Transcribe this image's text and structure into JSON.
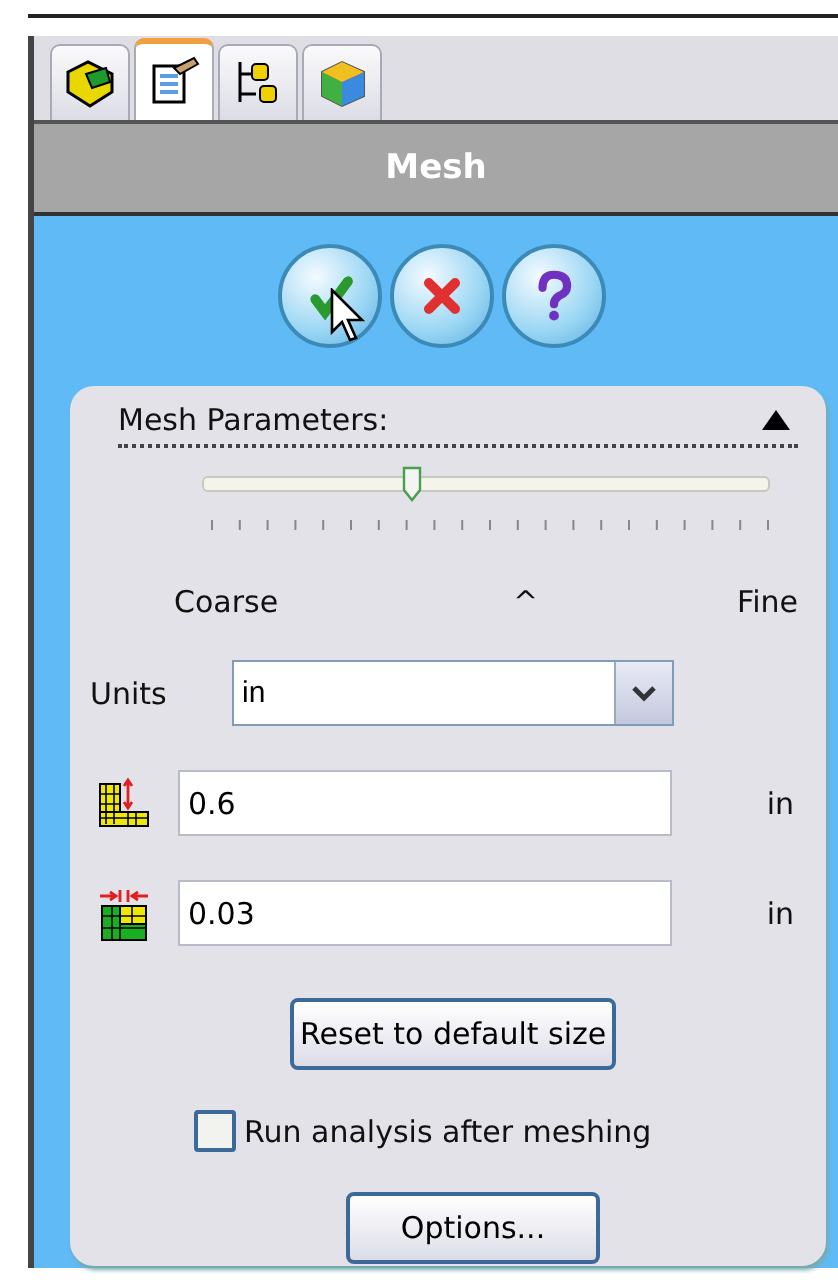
{
  "tabs": [
    {
      "kind": "part",
      "selected": false
    },
    {
      "kind": "properties",
      "selected": true
    },
    {
      "kind": "tree",
      "selected": false
    },
    {
      "kind": "cube",
      "selected": false
    }
  ],
  "title": "Mesh",
  "actions": [
    {
      "kind": "ok"
    },
    {
      "kind": "cancel"
    },
    {
      "kind": "help"
    }
  ],
  "section": {
    "title": "Mesh Parameters:",
    "expanded": true,
    "slider": {
      "level": 0.37,
      "min_label": "Coarse",
      "mid_label": "^",
      "max_label": "Fine"
    },
    "units": {
      "label": "Units",
      "value": "in"
    },
    "fields": [
      {
        "kind": "global-size",
        "value": "0.6",
        "unit": "in"
      },
      {
        "kind": "tolerance",
        "value": "0.03",
        "unit": "in"
      }
    ],
    "reset_button": "Reset to default size",
    "checkbox": {
      "label": "Run analysis after meshing",
      "checked": false
    },
    "options_button": "Options..."
  }
}
